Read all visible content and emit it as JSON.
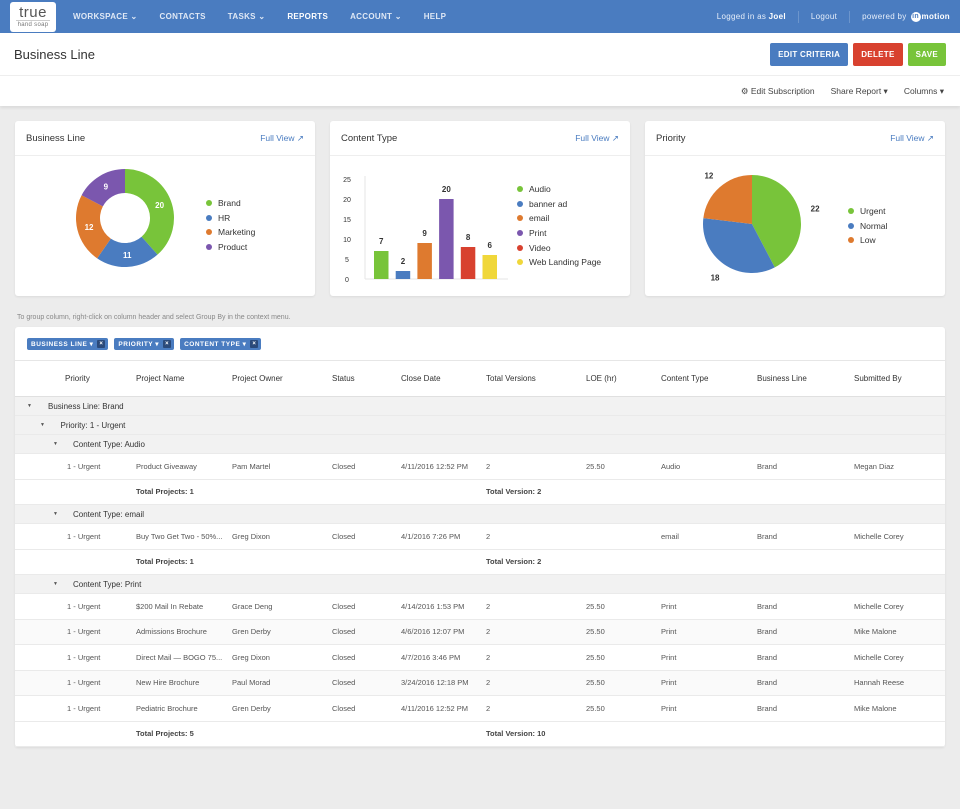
{
  "nav": {
    "logo_big": "true",
    "logo_small": "hand soap",
    "items": [
      "WORKSPACE ⌄",
      "CONTACTS",
      "TASKS ⌄",
      "REPORTS",
      "ACCOUNT ⌄",
      "HELP"
    ],
    "logged_in_prefix": "Logged in as ",
    "user": "Joel",
    "logout": "Logout",
    "powered_by": "powered by",
    "brand": "motion",
    "brand_dot": "in"
  },
  "header": {
    "title": "Business Line",
    "edit_criteria": "EDIT CRITERIA",
    "delete": "DELETE",
    "save": "SAVE"
  },
  "subbar": {
    "edit_subscription": "⚙ Edit Subscription",
    "share_report": "Share Report ▾",
    "columns": "Columns ▾"
  },
  "cards": {
    "business_line": {
      "title": "Business Line",
      "full_view": "Full View ↗"
    },
    "content_type": {
      "title": "Content Type",
      "full_view": "Full View ↗"
    },
    "priority": {
      "title": "Priority",
      "full_view": "Full View ↗"
    }
  },
  "chart_data": [
    {
      "type": "pie",
      "variant": "donut",
      "title": "Business Line",
      "categories": [
        "Brand",
        "HR",
        "Marketing",
        "Product"
      ],
      "values": [
        20,
        11,
        12,
        9
      ],
      "colors": [
        "#78c43a",
        "#4a7cc0",
        "#de7a2f",
        "#7b57ae"
      ],
      "legend": "right"
    },
    {
      "type": "bar",
      "title": "Content Type",
      "categories": [
        "Audio",
        "banner ad",
        "email",
        "Print",
        "Video",
        "Web Landing Page"
      ],
      "values": [
        7,
        2,
        9,
        20,
        8,
        6
      ],
      "colors": [
        "#78c43a",
        "#4a7cc0",
        "#de7a2f",
        "#7b57ae",
        "#d8412f",
        "#f0d73a"
      ],
      "yticks": [
        0,
        5,
        10,
        15,
        20,
        25
      ],
      "ylim": [
        0,
        25
      ],
      "xlabel": "",
      "ylabel": "",
      "legend": "right"
    },
    {
      "type": "pie",
      "title": "Priority",
      "categories": [
        "Urgent",
        "Normal",
        "Low"
      ],
      "values": [
        22,
        18,
        12
      ],
      "colors": [
        "#78c43a",
        "#4a7cc0",
        "#de7a2f"
      ],
      "legend": "right"
    }
  ],
  "hint": "To group column, right-click on column header and select Group By in the context menu.",
  "chips": [
    "BUSINESS LINE ▾",
    "PRIORITY ▾",
    "CONTENT TYPE ▾"
  ],
  "chip_remove": "×",
  "columns": [
    "Priority",
    "Project Name",
    "Project Owner",
    "Status",
    "Close Date",
    "Total Versions",
    "LOE (hr)",
    "Content Type",
    "Business Line",
    "Submitted By"
  ],
  "groups": {
    "business_line": "Business Line: Brand",
    "priority": "Priority: 1 - Urgent",
    "audio": "Content Type: Audio",
    "email": "Content Type: email",
    "print": "Content Type: Print"
  },
  "rows": {
    "audio": [
      [
        "1 - Urgent",
        "Product Giveaway",
        "Pam Martel",
        "Closed",
        "4/11/2016 12:52 PM",
        "2",
        "25.50",
        "Audio",
        "Brand",
        "Megan Diaz"
      ]
    ],
    "email": [
      [
        "1 - Urgent",
        "Buy Two Get Two - 50%...",
        "Greg Dixon",
        "Closed",
        "4/1/2016 7:26 PM",
        "2",
        "",
        "email",
        "Brand",
        "Michelle Corey"
      ]
    ],
    "print": [
      [
        "1 - Urgent",
        "$200 Mail In Rebate",
        "Grace Deng",
        "Closed",
        "4/14/2016 1:53 PM",
        "2",
        "25.50",
        "Print",
        "Brand",
        "Michelle Corey"
      ],
      [
        "1 - Urgent",
        "Admissions Brochure",
        "Gren Derby",
        "Closed",
        "4/6/2016 12:07 PM",
        "2",
        "25.50",
        "Print",
        "Brand",
        "Mike Malone"
      ],
      [
        "1 - Urgent",
        "Direct Mail — BOGO 75...",
        "Greg Dixon",
        "Closed",
        "4/7/2016 3:46 PM",
        "2",
        "25.50",
        "Print",
        "Brand",
        "Michelle Corey"
      ],
      [
        "1 - Urgent",
        "New Hire Brochure",
        "Paul Morad",
        "Closed",
        "3/24/2016 12:18 PM",
        "2",
        "25.50",
        "Print",
        "Brand",
        "Hannah Reese"
      ],
      [
        "1 - Urgent",
        "Pediatric Brochure",
        "Gren Derby",
        "Closed",
        "4/11/2016 12:52 PM",
        "2",
        "25.50",
        "Print",
        "Brand",
        "Mike Malone"
      ]
    ]
  },
  "totals": {
    "audio": {
      "projects": "Total Projects: 1",
      "versions": "Total Version: 2"
    },
    "email": {
      "projects": "Total Projects: 1",
      "versions": "Total Version: 2"
    },
    "print": {
      "projects": "Total Projects: 5",
      "versions": "Total Version: 10"
    }
  }
}
